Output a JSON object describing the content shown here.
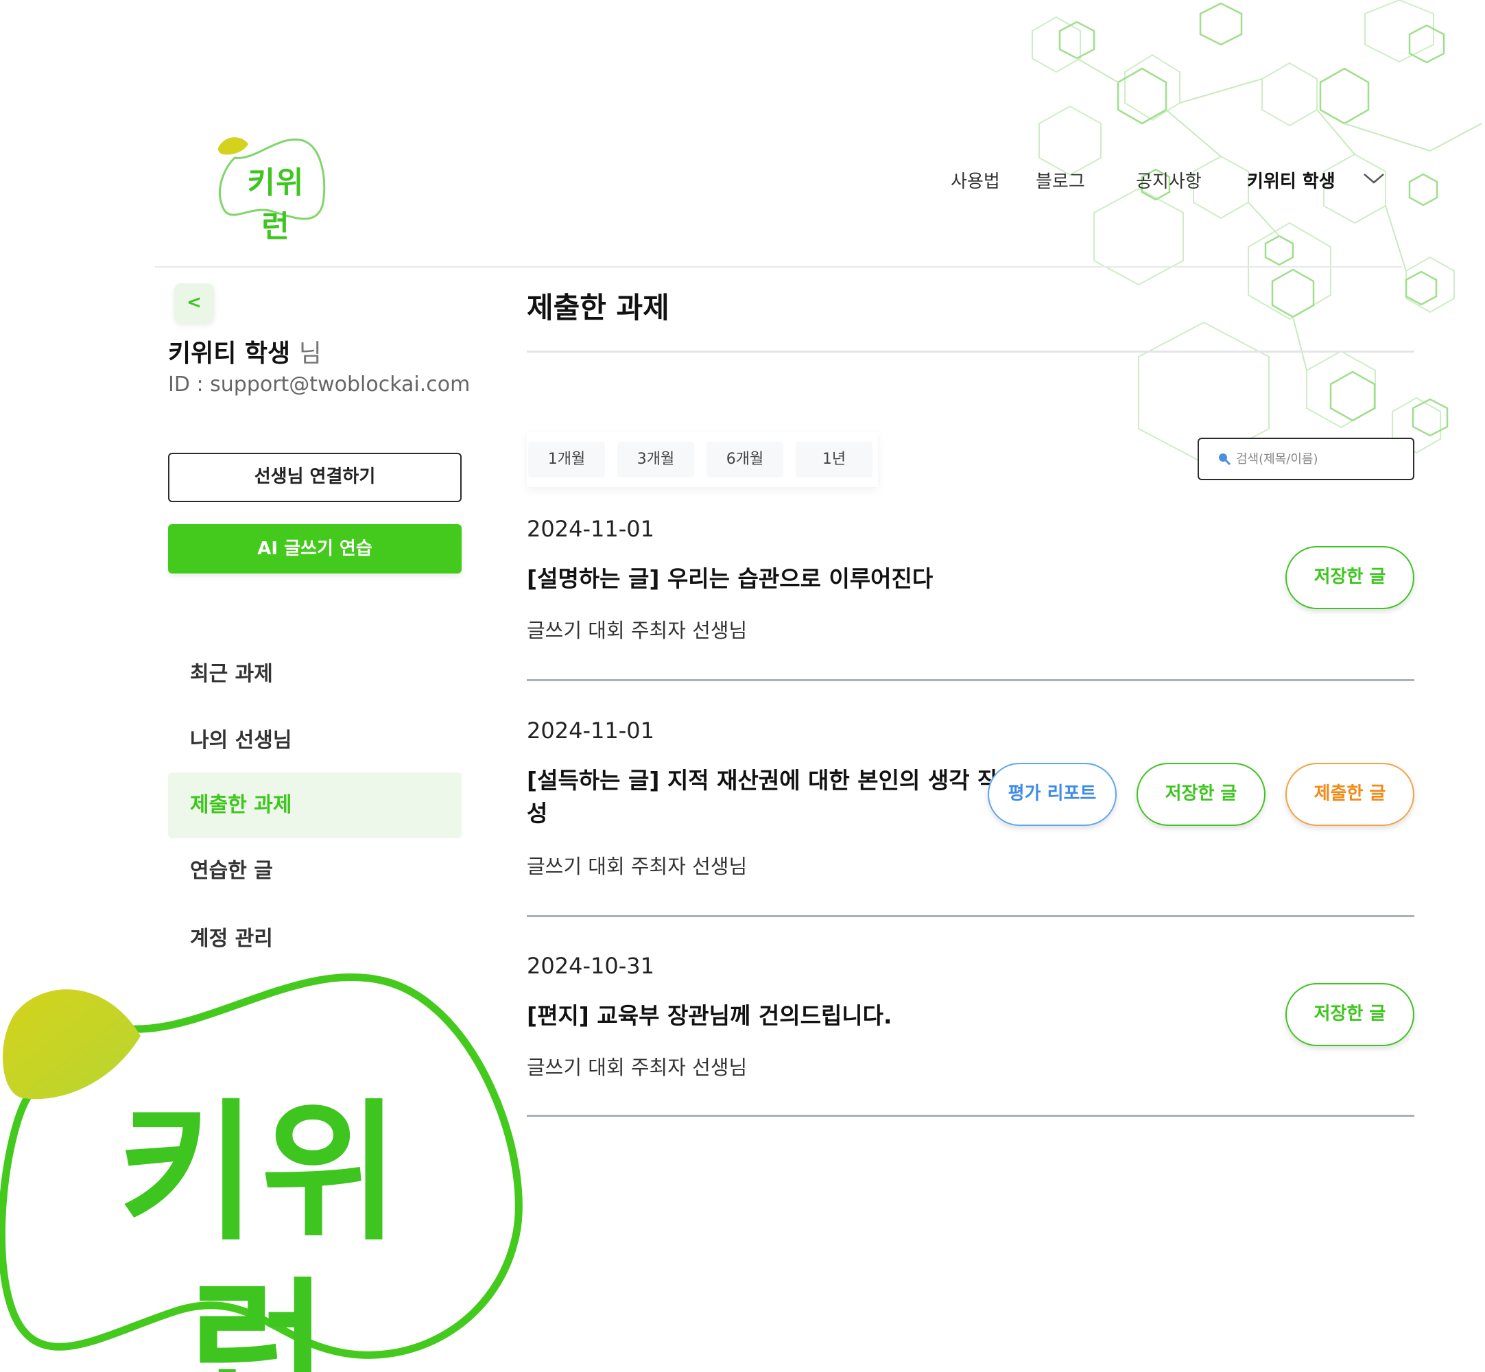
{
  "brand": {
    "logo_text": "키위런",
    "accent_color": "#44c91d",
    "leaf_color": "#d4d21c"
  },
  "header": {
    "nav": [
      {
        "label": "사용법"
      },
      {
        "label": "블로그"
      },
      {
        "label": "공지사항"
      }
    ],
    "user_menu_label": "키위티 학생",
    "user_menu_icon": "chevron-down-icon"
  },
  "sidebar": {
    "back_label": "<",
    "user_name": "키위티 학생",
    "user_suffix": "님",
    "user_id": "ID : support@twoblockai.com",
    "connect_button": "선생님 연결하기",
    "ai_button": "AI 글쓰기 연습",
    "menu": [
      {
        "label": "최근 과제",
        "active": false
      },
      {
        "label": "나의 선생님",
        "active": false
      },
      {
        "label": "제출한 과제",
        "active": true
      },
      {
        "label": "연습한 글",
        "active": false
      },
      {
        "label": "계정 관리",
        "active": false
      }
    ]
  },
  "main": {
    "title": "제출한 과제",
    "period_tabs": [
      "1개월",
      "3개월",
      "6개월",
      "1년"
    ],
    "search_placeholder": "검색(제목/이름)",
    "search_icon": "magnifier-icon",
    "assignments": [
      {
        "date": "2024-11-01",
        "title": "[설명하는 글] 우리는 습관으로 이루어진다",
        "teacher": "글쓰기 대회 주최자 선생님",
        "buttons": [
          "저장한 글"
        ]
      },
      {
        "date": "2024-11-01",
        "title": "[설득하는 글] 지적 재산권에 대한 본인의 생각 작성",
        "teacher": "글쓰기 대회 주최자 선생님",
        "buttons": [
          "평가 리포트",
          "저장한 글",
          "제출한 글"
        ]
      },
      {
        "date": "2024-10-31",
        "title": "[편지] 교육부 장관님께 건의드립니다.",
        "teacher": "글쓰기 대회 주최자 선생님",
        "buttons": [
          "저장한 글"
        ]
      }
    ]
  }
}
